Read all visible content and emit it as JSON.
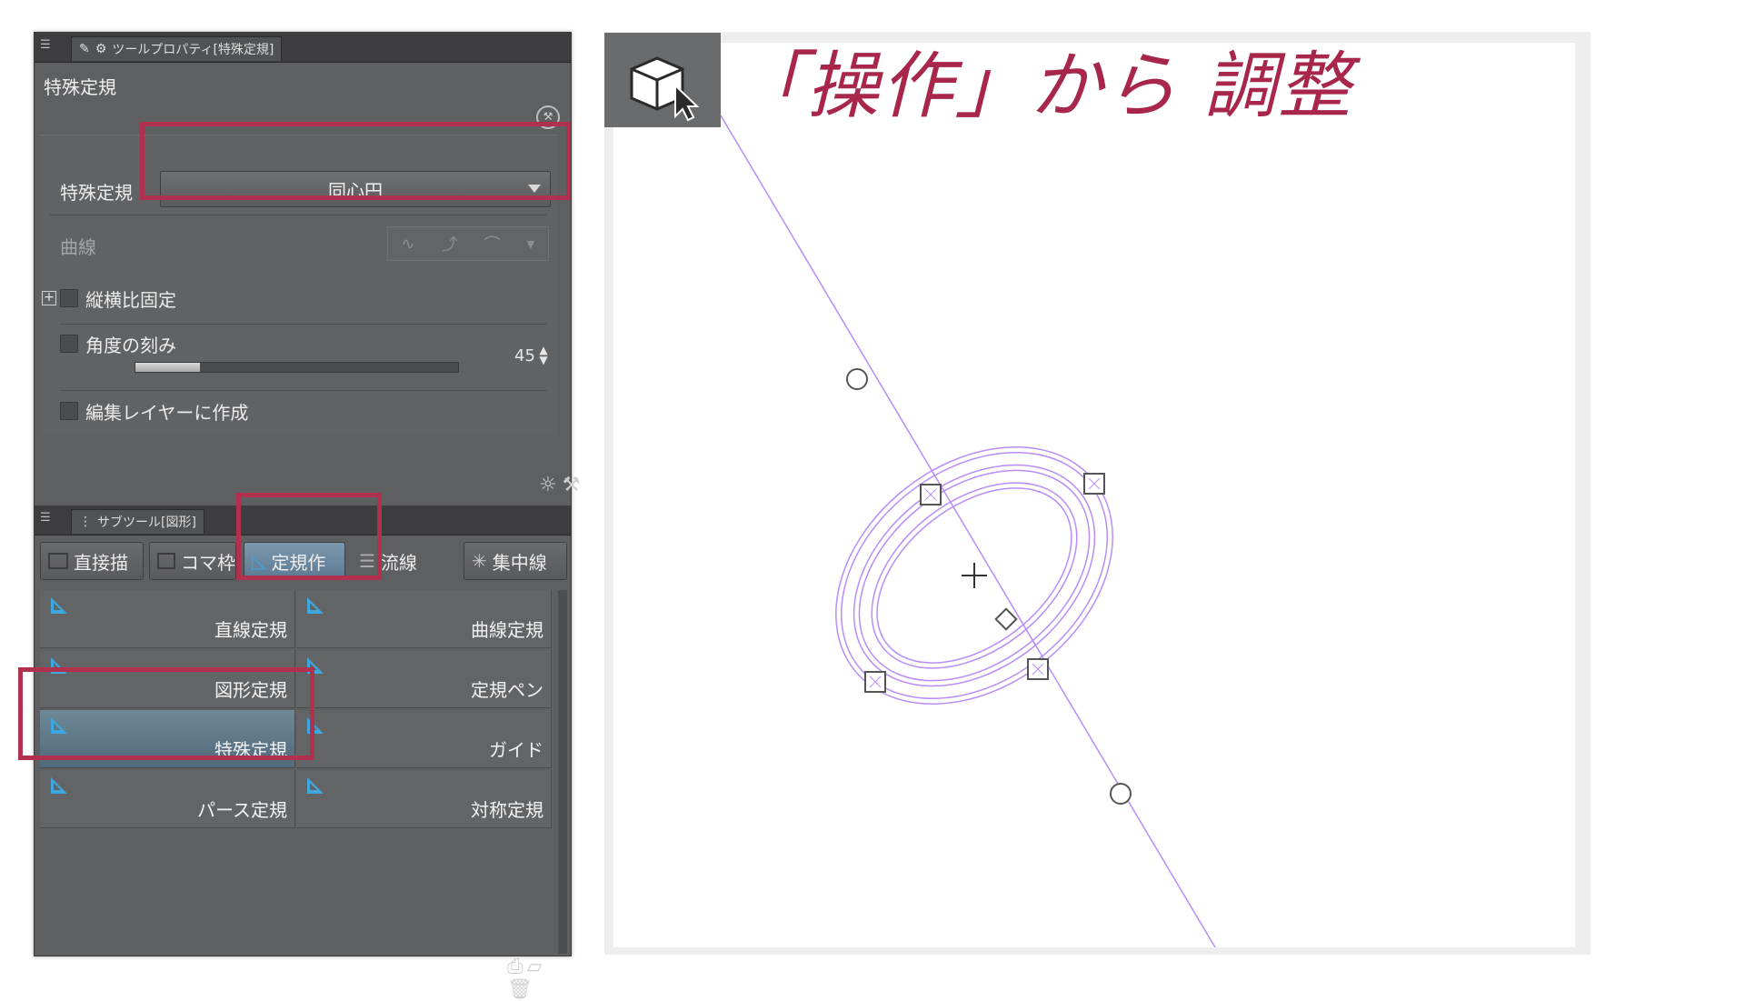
{
  "tool_property_panel": {
    "tab_title": "ツールプロパティ[特殊定規]",
    "tool_name": "特殊定規",
    "special_ruler_label": "特殊定規",
    "special_ruler_value": "同心円",
    "curve_label": "曲線",
    "fix_aspect_label": "縦横比固定",
    "angle_step_label": "角度の刻み",
    "angle_step_value": "45",
    "angle_step_fraction": 0.2,
    "create_on_layer_label": "編集レイヤーに作成"
  },
  "sub_tool_panel": {
    "tab_title": "サブツール[図形]",
    "tabs": [
      "直接描",
      "コマ枠",
      "定規作",
      "流線",
      "集中線"
    ],
    "active_tab_index": 2,
    "items": [
      "直線定規",
      "曲線定規",
      "図形定規",
      "定規ペン",
      "特殊定規",
      "ガイド",
      "パース定規",
      "対称定規"
    ],
    "selected_item": "特殊定規"
  },
  "canvas": {
    "heading": "「操作」から 調整",
    "operation_icon": "object-select-icon"
  },
  "colors": {
    "highlight": "#b0304d",
    "heading": "#a8264a",
    "guide": "#b98cf7",
    "panel_bg": "#5e5f61"
  }
}
